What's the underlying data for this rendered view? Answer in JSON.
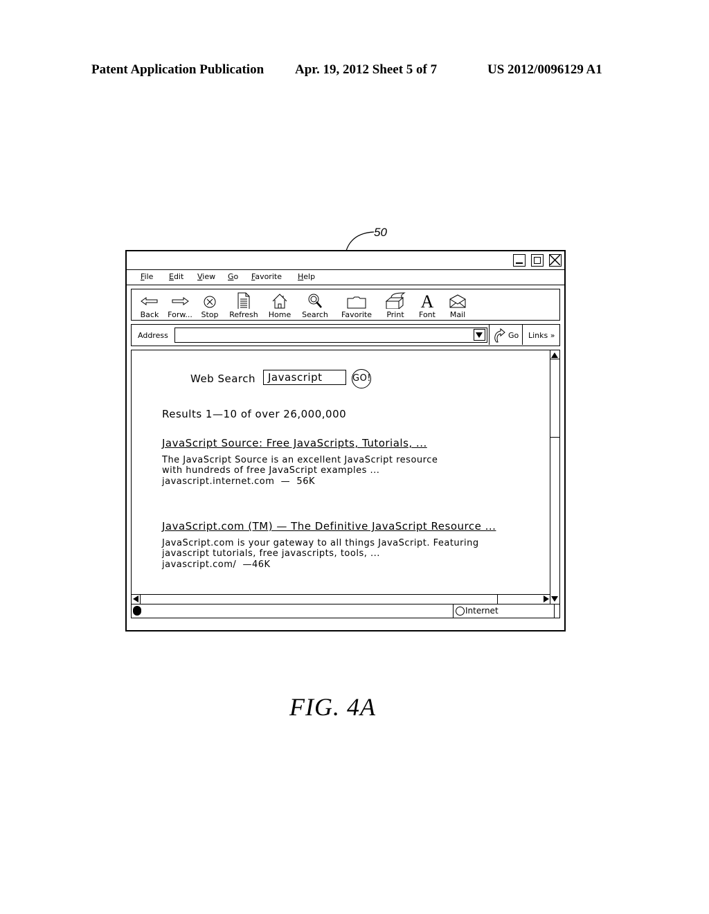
{
  "header": {
    "publication": "Patent Application Publication",
    "date_sheet": "Apr. 19, 2012  Sheet 5 of 7",
    "patent_number": "US 2012/0096129 A1"
  },
  "reference_numeral": "50",
  "browser": {
    "window_controls": [
      "minimize",
      "maximize",
      "close"
    ],
    "menu": [
      "File",
      "Edit",
      "View",
      "Go",
      "Favorite",
      "Help"
    ],
    "toolbar": [
      {
        "label": "Back",
        "icon": "arrow-left-icon"
      },
      {
        "label": "Forw...",
        "icon": "arrow-right-icon"
      },
      {
        "label": "Stop",
        "icon": "stop-icon"
      },
      {
        "label": "Refresh",
        "icon": "document-icon"
      },
      {
        "label": "Home",
        "icon": "home-icon"
      },
      {
        "label": "Search",
        "icon": "magnifier-icon"
      },
      {
        "label": "Favorite",
        "icon": "folder-icon"
      },
      {
        "label": "Print",
        "icon": "printer-icon"
      },
      {
        "label": "Font",
        "icon": "font-icon"
      },
      {
        "label": "Mail",
        "icon": "envelope-icon"
      }
    ],
    "address": {
      "label": "Address",
      "value": "",
      "go_label": "Go",
      "links_label": "Links »"
    },
    "status": {
      "zone": "Internet"
    }
  },
  "page": {
    "search_label": "Web Search",
    "search_value": "Javascript",
    "go_button": "GO!",
    "results_count": "Results 1—10 of over 26,000,000",
    "results": [
      {
        "title": "JavaScript Source: Free JavaScripts, Tutorials, ...",
        "desc_lines": [
          "The JavaScript Source is an excellent JavaScript resource",
          "with hundreds of free JavaScript examples ...",
          "javascript.internet.com  —  56K"
        ]
      },
      {
        "title": "JavaScript.com (TM) — The Definitive JavaScript Resource ...",
        "desc_lines": [
          "JavaScript.com is your gateway to all things JavaScript. Featuring",
          "javascript tutorials, free javascripts, tools, ...",
          "javascript.com/  —46K"
        ]
      }
    ]
  },
  "figure_label": "FIG.  4A"
}
